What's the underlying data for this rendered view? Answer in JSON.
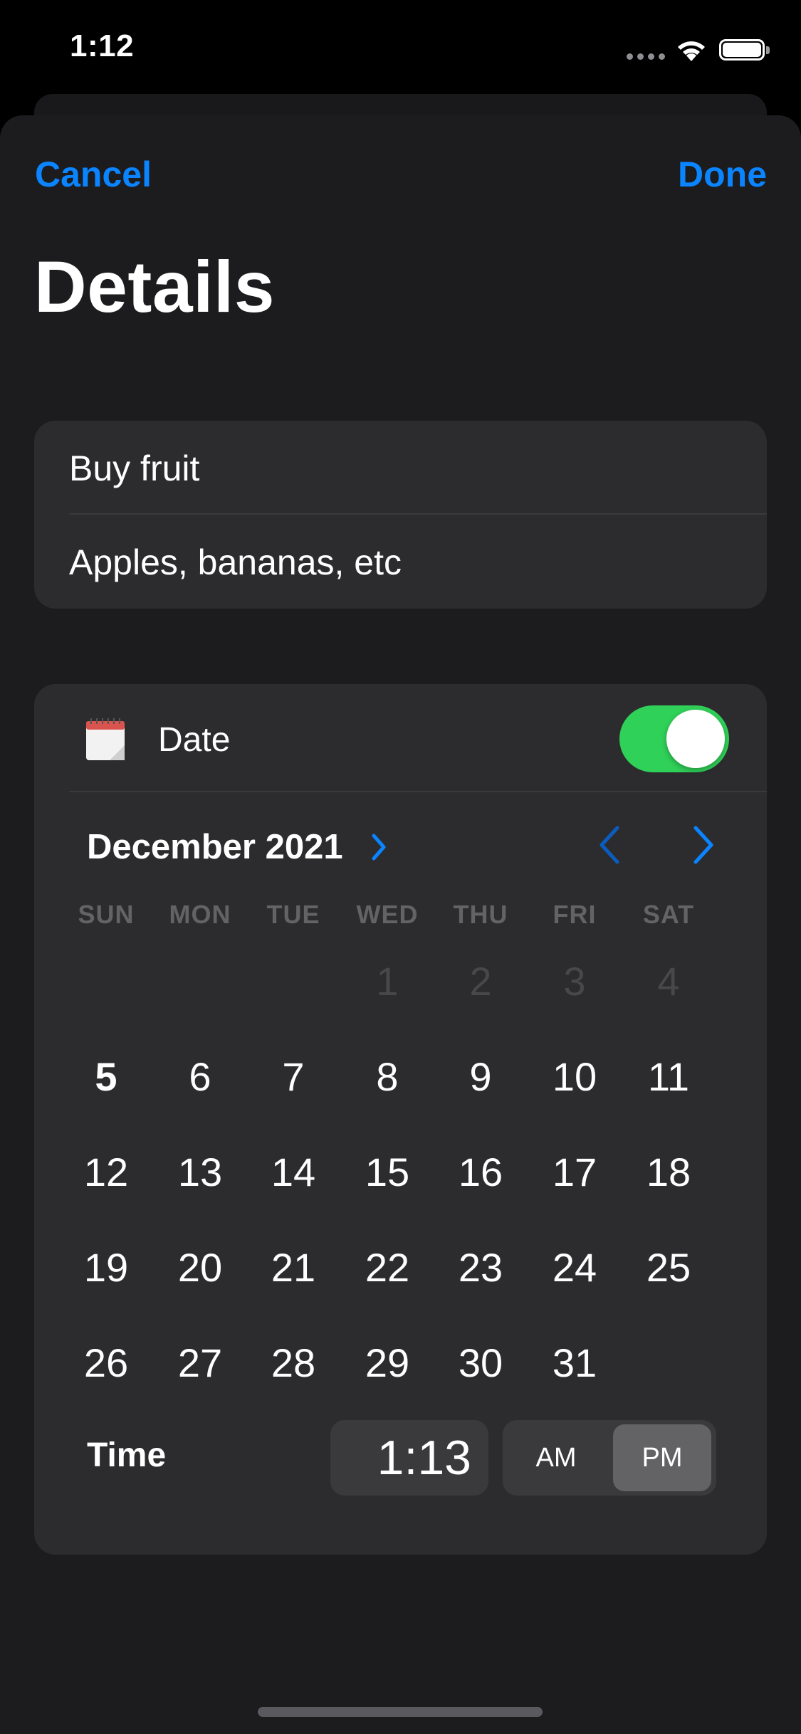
{
  "status_bar": {
    "time": "1:12"
  },
  "nav": {
    "cancel": "Cancel",
    "done": "Done"
  },
  "title": "Details",
  "reminder": {
    "title": "Buy fruit",
    "notes": "Apples, bananas, etc"
  },
  "date_row": {
    "label": "Date",
    "toggle_on": true,
    "icon": "calendar-icon"
  },
  "calendar": {
    "month_label": "December 2021",
    "weekdays": [
      "SUN",
      "MON",
      "TUE",
      "WED",
      "THU",
      "FRI",
      "SAT"
    ],
    "prev_month_days": [
      "1",
      "2",
      "3",
      "4"
    ],
    "days": [
      "5",
      "6",
      "7",
      "8",
      "9",
      "10",
      "11",
      "12",
      "13",
      "14",
      "15",
      "16",
      "17",
      "18",
      "19",
      "20",
      "21",
      "22",
      "23",
      "24",
      "25",
      "26",
      "27",
      "28",
      "29",
      "30",
      "31"
    ],
    "selected_day": "5"
  },
  "time_row": {
    "label": "Time",
    "value": "1:13",
    "am": "AM",
    "pm": "PM",
    "selected": "PM"
  },
  "colors": {
    "accent": "#0a84ff",
    "toggle": "#30d158",
    "group_bg": "#2c2c2e",
    "sheet_bg": "#1c1c1e"
  }
}
